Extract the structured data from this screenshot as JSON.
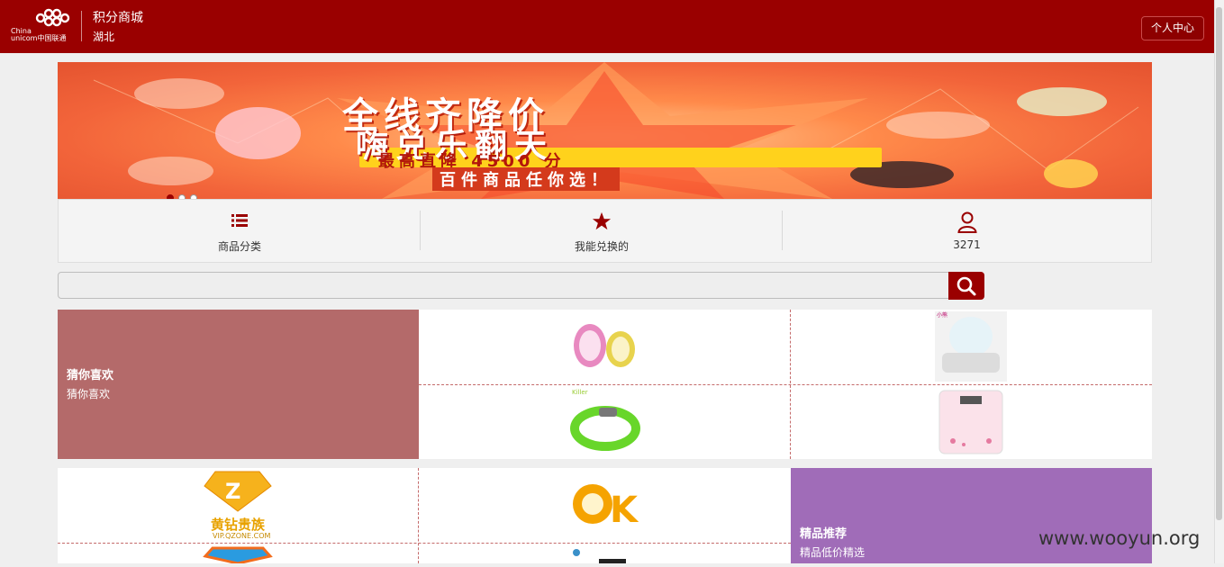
{
  "header": {
    "brand_line1": "China",
    "brand_line2": "unicom中国联通",
    "app_title": "积分商城",
    "region": "湖北",
    "user_center": "个人中心"
  },
  "banner": {
    "line1": "全线齐降价",
    "line2": "嗨兑乐翻天",
    "line3": "最高直降 4500 分",
    "line4": "百件商品任你选！",
    "slides": 3,
    "active_slide": 1
  },
  "nav": {
    "items": [
      {
        "label": "商品分类",
        "icon": "list-icon"
      },
      {
        "label": "我能兑换的",
        "icon": "star-icon"
      },
      {
        "label": "3271",
        "icon": "user-icon"
      }
    ]
  },
  "search": {
    "placeholder": "",
    "value": ""
  },
  "sections": {
    "guess": {
      "title": "猜你喜欢",
      "subtitle": "猜你喜欢",
      "color": "#b46a6a"
    },
    "premium": {
      "title": "精品推荐",
      "subtitle": "精品低价精选",
      "color": "#a06cb8"
    }
  },
  "products": {
    "row1": [
      "mini-fan",
      "ice-cream-maker",
      "neck-fan",
      "body-scale"
    ],
    "row2": [
      "yellow-diamond-vip",
      "ok-fan",
      "blue-diamond-vip",
      "gadget"
    ],
    "yellow_diamond_text": "黄钻贵族",
    "yellow_diamond_url": "VIP.QZONE.COM",
    "brand_small": "Killer"
  },
  "watermark": "www.wooyun.org",
  "colors": {
    "brand": "#9a0000",
    "guess": "#b46a6a",
    "premium": "#a06cb8"
  }
}
